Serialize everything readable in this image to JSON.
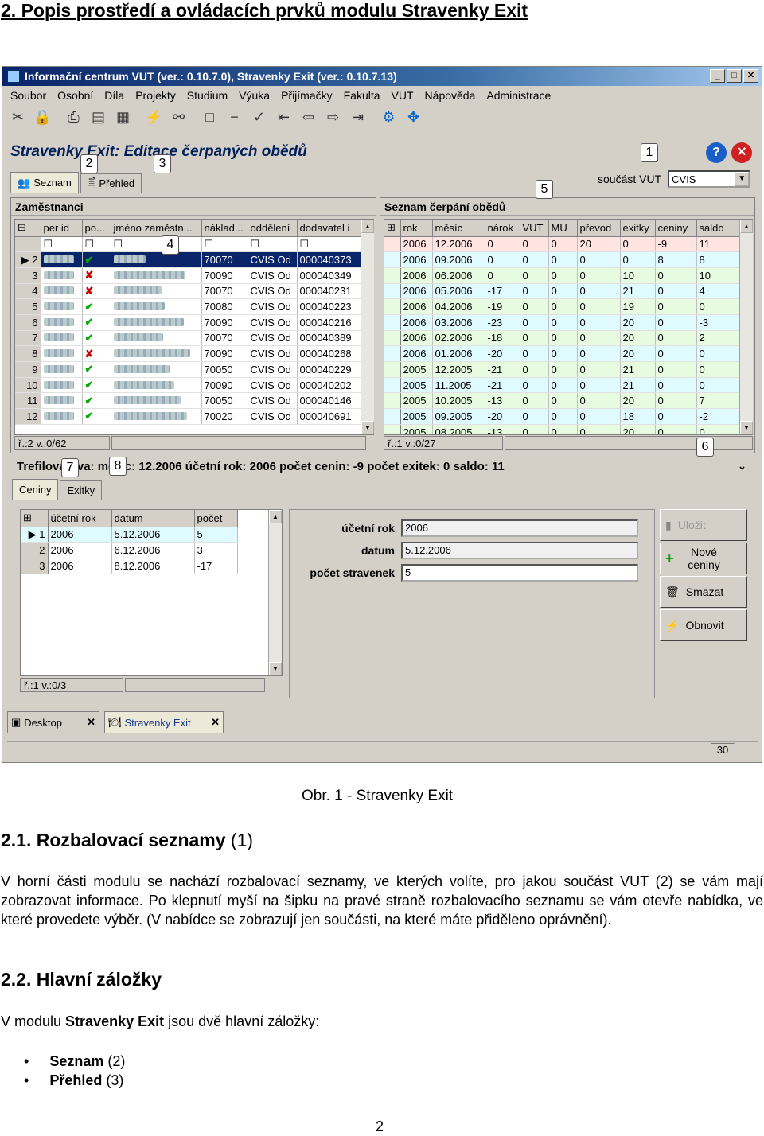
{
  "doc": {
    "heading": "2. Popis prostředí a ovládacích prvků modulu Stravenky Exit",
    "caption": "Obr. 1 - Stravenky Exit",
    "sec1_num": "2.1.",
    "sec1_title": "Rozbalovací seznamy",
    "sec1_ref": "(1)",
    "sec1_text": "V horní části modulu se nachází rozbalovací seznamy, ve kterých volíte, pro jakou součást VUT (2) se vám mají zobrazovat informace. Po klepnutí myší na šipku na pravé straně rozbalovacího seznamu se vám otevře nabídka, ve které provedete výběr. (V nabídce se zobrazují jen součásti, na které máte přiděleno oprávnění).",
    "sec2_num": "2.2.",
    "sec2_title": "Hlavní záložky",
    "sec2_text_pre": "V modulu ",
    "sec2_text_bold": "Stravenky Exit",
    "sec2_text_post": " jsou dvě hlavní záložky:",
    "bullets": [
      {
        "bold": "Seznam",
        "ref": "(2)"
      },
      {
        "bold": "Přehled",
        "ref": "(3)"
      }
    ],
    "page_number": "2"
  },
  "app": {
    "title": "Informační centrum VUT (ver.: 0.10.7.0), Stravenky Exit (ver.: 0.10.7.13)",
    "menu": [
      "Soubor",
      "Osobní",
      "Díla",
      "Projekty",
      "Studium",
      "Výuka",
      "Přijímačky",
      "Fakulta",
      "VUT",
      "Nápověda",
      "Administrace"
    ],
    "module_title": "Stravenky Exit:  Editace čerpaných obědů",
    "vut_label": "součást VUT",
    "vut_value": "CVIS",
    "tabs": [
      "Seznam",
      "Přehled"
    ],
    "employees": {
      "title": "Zaměstnanci",
      "columns": [
        "per id",
        "po...",
        "jméno zaměstn...",
        "náklad...",
        "oddělení",
        "dodavatel i"
      ],
      "rows": [
        {
          "n": "2",
          "ok": true,
          "cost": "70070",
          "dept": "CVIS Od",
          "sup": "000040373"
        },
        {
          "n": "3",
          "ok": false,
          "cost": "70090",
          "dept": "CVIS Od",
          "sup": "000040349"
        },
        {
          "n": "4",
          "ok": false,
          "cost": "70070",
          "dept": "CVIS Od",
          "sup": "000040231"
        },
        {
          "n": "5",
          "ok": true,
          "cost": "70080",
          "dept": "CVIS Od",
          "sup": "000040223"
        },
        {
          "n": "6",
          "ok": true,
          "cost": "70090",
          "dept": "CVIS Od",
          "sup": "000040216"
        },
        {
          "n": "7",
          "ok": true,
          "cost": "70070",
          "dept": "CVIS Od",
          "sup": "000040389"
        },
        {
          "n": "8",
          "ok": false,
          "cost": "70090",
          "dept": "CVIS Od",
          "sup": "000040268"
        },
        {
          "n": "9",
          "ok": true,
          "cost": "70050",
          "dept": "CVIS Od",
          "sup": "000040229"
        },
        {
          "n": "10",
          "ok": true,
          "cost": "70090",
          "dept": "CVIS Od",
          "sup": "000040202"
        },
        {
          "n": "11",
          "ok": true,
          "cost": "70050",
          "dept": "CVIS Od",
          "sup": "000040146"
        },
        {
          "n": "12",
          "ok": true,
          "cost": "70020",
          "dept": "CVIS Od",
          "sup": "000040691"
        }
      ],
      "status": "ř.:2 v.:0/62"
    },
    "meals": {
      "title": "Seznam čerpání obědů",
      "columns": [
        "rok",
        "měsíc",
        "nárok",
        "VUT",
        "MU",
        "převod",
        "exitky",
        "ceniny",
        "saldo"
      ],
      "rows": [
        [
          "2006",
          "12.2006",
          "0",
          "0",
          "0",
          "20",
          "0",
          "-9",
          "11"
        ],
        [
          "2006",
          "09.2006",
          "0",
          "0",
          "0",
          "0",
          "0",
          "8",
          "8"
        ],
        [
          "2006",
          "06.2006",
          "0",
          "0",
          "0",
          "0",
          "10",
          "0",
          "10"
        ],
        [
          "2006",
          "05.2006",
          "-17",
          "0",
          "0",
          "0",
          "21",
          "0",
          "4"
        ],
        [
          "2006",
          "04.2006",
          "-19",
          "0",
          "0",
          "0",
          "19",
          "0",
          "0"
        ],
        [
          "2006",
          "03.2006",
          "-23",
          "0",
          "0",
          "0",
          "20",
          "0",
          "-3"
        ],
        [
          "2006",
          "02.2006",
          "-18",
          "0",
          "0",
          "0",
          "20",
          "0",
          "2"
        ],
        [
          "2006",
          "01.2006",
          "-20",
          "0",
          "0",
          "0",
          "20",
          "0",
          "0"
        ],
        [
          "2005",
          "12.2005",
          "-21",
          "0",
          "0",
          "0",
          "21",
          "0",
          "0"
        ],
        [
          "2005",
          "11.2005",
          "-21",
          "0",
          "0",
          "0",
          "21",
          "0",
          "0"
        ],
        [
          "2005",
          "10.2005",
          "-13",
          "0",
          "0",
          "0",
          "20",
          "0",
          "7"
        ],
        [
          "2005",
          "09.2005",
          "-20",
          "0",
          "0",
          "0",
          "18",
          "0",
          "-2"
        ],
        [
          "2005",
          "08.2005",
          "-13",
          "0",
          "0",
          "0",
          "20",
          "0",
          "0"
        ]
      ],
      "status": "ř.:1 v.:0/27"
    },
    "summary": "Trefilová Eva: měsíc: 12.2006 účetní rok: 2006 počet cenin: -9 počet exitek: 0 saldo: 11",
    "subtabs": [
      "Ceniny",
      "Exitky"
    ],
    "vouchers": {
      "columns": [
        "účetní rok",
        "datum",
        "počet"
      ],
      "rows": [
        {
          "n": "1",
          "year": "2006",
          "date": "5.12.2006",
          "count": "5"
        },
        {
          "n": "2",
          "year": "2006",
          "date": "6.12.2006",
          "count": "3"
        },
        {
          "n": "3",
          "year": "2006",
          "date": "8.12.2006",
          "count": "-17"
        }
      ],
      "status": "ř.:1 v.:0/3"
    },
    "form": {
      "year_label": "účetní rok",
      "year_value": "2006",
      "date_label": "datum",
      "date_value": "5.12.2006",
      "count_label": "počet stravenek",
      "count_value": "5"
    },
    "buttons": {
      "save": "Uložit",
      "new": "Nové ceniny",
      "delete": "Smazat",
      "refresh": "Obnovit"
    },
    "taskbar": [
      "Desktop",
      "Stravenky Exit"
    ],
    "status_value": "30",
    "callouts": [
      "1",
      "2",
      "3",
      "4",
      "5",
      "6",
      "7",
      "8"
    ]
  }
}
